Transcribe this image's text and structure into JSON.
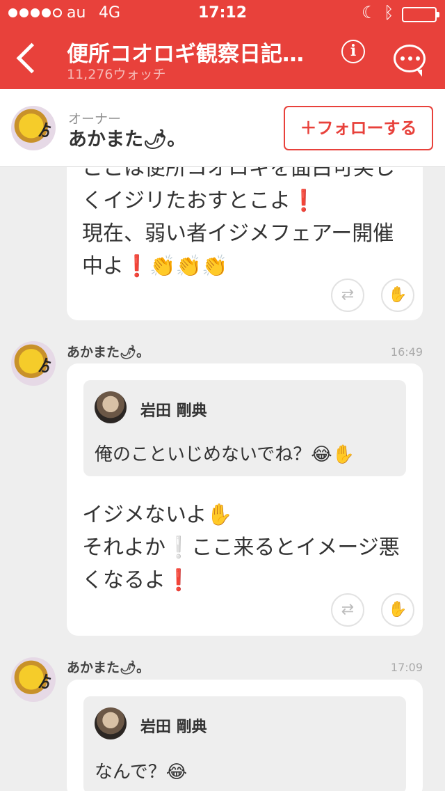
{
  "status_bar": {
    "carrier": "au",
    "network": "4G",
    "time": "17:12"
  },
  "header": {
    "title": "便所コオロギ観察日記…",
    "watch_count": "11,276ウォッチ"
  },
  "owner": {
    "label": "オーナー",
    "name": "あかまた🌶。",
    "follow_button": "＋フォローする"
  },
  "messages": [
    {
      "lines": [
        "ここは便所コオロギを面白可笑し",
        "くイジリたおすとこよ❗",
        "現在、弱い者イジメフェアー開催",
        "中よ❗👏👏👏"
      ]
    },
    {
      "author": "あかまた🌶。",
      "time": "16:49",
      "quote_name": "岩田 剛典",
      "quote_text": "俺のこといじめないでね？😂✋",
      "lines": [
        "イジメないよ✋",
        "それよか❕ここ来るとイメージ悪",
        "くなるよ❗"
      ]
    },
    {
      "author": "あかまた🌶。",
      "time": "17:09",
      "quote_name": "岩田 剛典",
      "quote_text": "なんで？😂"
    }
  ],
  "icons": {
    "back": "chevron-left-icon",
    "info": "info-icon",
    "chat": "chat-bubble-icon",
    "repost": "repost-icon",
    "clap": "clap-hand-icon"
  },
  "colors": {
    "brand_red": "#e8413b"
  }
}
